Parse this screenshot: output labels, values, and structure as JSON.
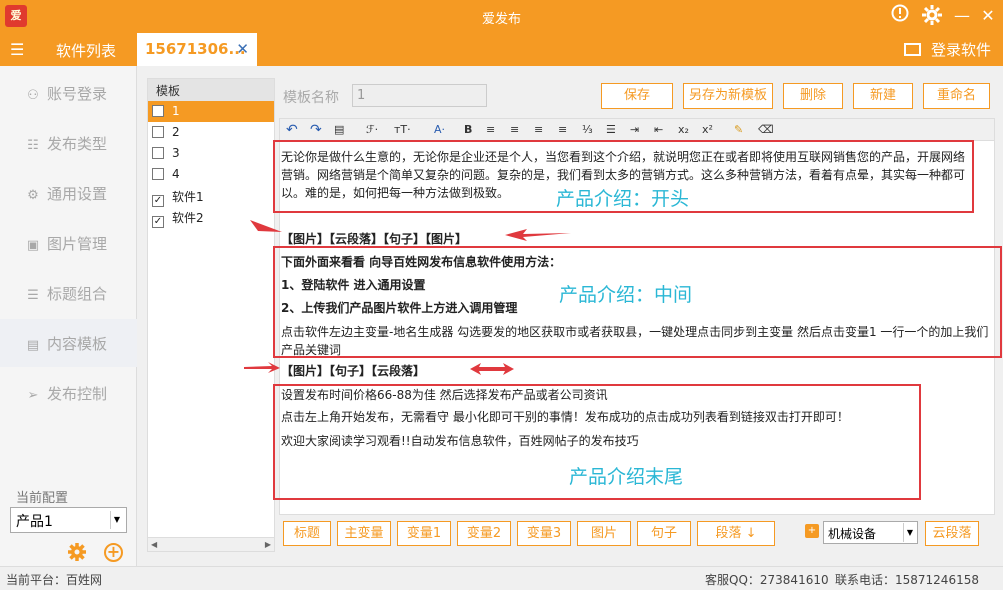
{
  "window": {
    "title": "爱发布",
    "logo_text": "爱",
    "info_icon": "info-icon",
    "settings_icon": "gear-icon",
    "min_glyph": "—",
    "close_glyph": "✕"
  },
  "tabbar": {
    "menu_glyph": "☰",
    "software_list": "软件列表",
    "active_tab": "15671306...",
    "close_glyph": "✕",
    "login": "登录软件"
  },
  "sidebar": {
    "items": [
      {
        "icon": "user-icon",
        "glyph": "⚇",
        "label": "账号登录"
      },
      {
        "icon": "list-icon",
        "glyph": "☷",
        "label": "发布类型"
      },
      {
        "icon": "settings-icon",
        "glyph": "⚙",
        "label": "通用设置"
      },
      {
        "icon": "image-icon",
        "glyph": "▣",
        "label": "图片管理"
      },
      {
        "icon": "title-icon",
        "glyph": "☰",
        "label": "标题组合"
      },
      {
        "icon": "content-icon",
        "glyph": "▤",
        "label": "内容模板"
      },
      {
        "icon": "send-icon",
        "glyph": "➢",
        "label": "发布控制"
      }
    ],
    "current_label": "当前配置",
    "current_value": "产品1"
  },
  "templates": {
    "header": "模板",
    "rows": [
      {
        "label": "1",
        "checked": ""
      },
      {
        "label": "2",
        "checked": ""
      },
      {
        "label": "3",
        "checked": ""
      },
      {
        "label": "4",
        "checked": ""
      },
      {
        "label": "软件1",
        "checked": "✓"
      },
      {
        "label": "软件2",
        "checked": "✓"
      }
    ]
  },
  "form": {
    "name_label": "模板名称",
    "name_value": "1",
    "save": "保存",
    "save_as": "另存为新模板",
    "delete": "删除",
    "new": "新建",
    "rename": "重命名"
  },
  "toolbar": {
    "undo": "↶",
    "redo": "↷",
    "paste": "▤",
    "font": "ℱ·",
    "size": "тT·",
    "color": "A·",
    "bold": "B",
    "align_left": "≡",
    "align_center": "≡",
    "align_right": "≡",
    "justify": "≡",
    "ol": "⅓",
    "ul": "☰",
    "indent_in": "⇥",
    "indent_out": "⇤",
    "sub": "x₂",
    "sup": "x²",
    "brush": "✎",
    "eraser": "⌫"
  },
  "content": {
    "intro": "无论你是做什么生意的，无论你是企业还是个人，当您看到这个介绍，就说明您正在或者即将使用互联网销售您的产品，开展网络营销。网络营销是个简单又复杂的问题。复杂的是，我们看到太多的营销方式。这么多种营销方法，看着有点晕，其实每一种都可以。难的是，如何把每一种方法做到极致。",
    "tags1": "【图片】【云段落】【句子】【图片】",
    "h1": "下面外面来看看 向导百姓网发布信息软件使用方法：",
    "h2": "1、登陆软件 进入通用设置",
    "h3": "2、上传我们产品图片软件上方进入调用管理",
    "middle": "点击软件左边主变量-地名生成器 勾选要发的地区获取市或者获取县，一键处理点击同步到主变量 然后点击变量1 一行一个的加上我们产品关键词",
    "tags2": "【图片】【句子】【云段落】",
    "end1": "设置发布时间价格66-88为佳 然后选择发布产品或者公司资讯",
    "end2": "点击左上角开始发布，无需看守 最小化即可干别的事情！发布成功的点击成功列表看到链接双击打开即可！",
    "end3": "欢迎大家阅读学习观看!!自动发布信息软件，百姓网帖子的发布技巧"
  },
  "annotations": {
    "start": "产品介绍：开头",
    "middle": "产品介绍：中间",
    "end": "产品介绍末尾"
  },
  "bottom": {
    "title": "标题",
    "main_var": "主变量",
    "var1": "变量1",
    "var2": "变量2",
    "var3": "变量3",
    "image": "图片",
    "sentence": "句子",
    "paragraph": "段落 ↓",
    "category": "机械设备",
    "cloud_para": "云段落"
  },
  "status": {
    "platform": "当前平台：百姓网",
    "qq": "客服QQ：273841610",
    "phone": "联系电话：15871246158"
  },
  "colors": {
    "accent": "#f59a23",
    "annotation_box": "#e0393e",
    "annotation_text": "#2ab7d5"
  }
}
